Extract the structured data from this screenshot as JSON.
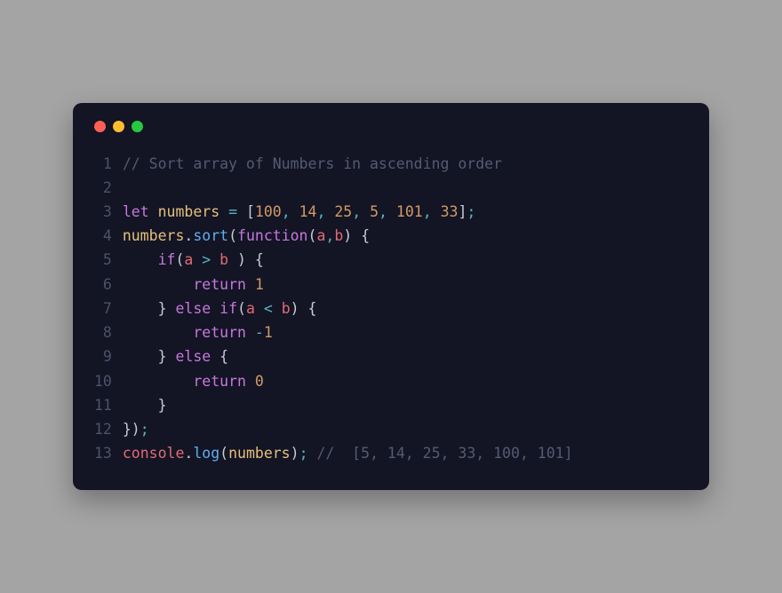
{
  "window": {
    "dots": [
      "red",
      "yellow",
      "green"
    ]
  },
  "code": {
    "numbers_array": [
      100,
      14,
      25,
      5,
      101,
      33
    ],
    "sorted_result": [
      5,
      14,
      25,
      33,
      100,
      101
    ],
    "lines": [
      {
        "n": "1",
        "tokens": [
          [
            "comment",
            "// Sort array of Numbers in ascending order"
          ]
        ]
      },
      {
        "n": "2",
        "tokens": []
      },
      {
        "n": "3",
        "tokens": [
          [
            "kw",
            "let"
          ],
          [
            "txt",
            " "
          ],
          [
            "var",
            "numbers"
          ],
          [
            "txt",
            " "
          ],
          [
            "op",
            "="
          ],
          [
            "txt",
            " "
          ],
          [
            "punct",
            "["
          ],
          [
            "num",
            "100"
          ],
          [
            "op",
            ","
          ],
          [
            "txt",
            " "
          ],
          [
            "num",
            "14"
          ],
          [
            "op",
            ","
          ],
          [
            "txt",
            " "
          ],
          [
            "num",
            "25"
          ],
          [
            "op",
            ","
          ],
          [
            "txt",
            " "
          ],
          [
            "num",
            "5"
          ],
          [
            "op",
            ","
          ],
          [
            "txt",
            " "
          ],
          [
            "num",
            "101"
          ],
          [
            "op",
            ","
          ],
          [
            "txt",
            " "
          ],
          [
            "num",
            "33"
          ],
          [
            "punct",
            "]"
          ],
          [
            "op",
            ";"
          ]
        ]
      },
      {
        "n": "4",
        "tokens": [
          [
            "var",
            "numbers"
          ],
          [
            "punct",
            "."
          ],
          [
            "method",
            "sort"
          ],
          [
            "punct",
            "("
          ],
          [
            "kw",
            "function"
          ],
          [
            "punct",
            "("
          ],
          [
            "ident",
            "a"
          ],
          [
            "op",
            ","
          ],
          [
            "ident",
            "b"
          ],
          [
            "punct",
            ")"
          ],
          [
            "txt",
            " "
          ],
          [
            "punct",
            "{"
          ]
        ]
      },
      {
        "n": "5",
        "tokens": [
          [
            "txt",
            "    "
          ],
          [
            "kw",
            "if"
          ],
          [
            "punct",
            "("
          ],
          [
            "ident",
            "a"
          ],
          [
            "txt",
            " "
          ],
          [
            "op",
            ">"
          ],
          [
            "txt",
            " "
          ],
          [
            "ident",
            "b"
          ],
          [
            "txt",
            " "
          ],
          [
            "punct",
            ")"
          ],
          [
            "txt",
            " "
          ],
          [
            "punct",
            "{"
          ]
        ]
      },
      {
        "n": "6",
        "tokens": [
          [
            "txt",
            "        "
          ],
          [
            "kw",
            "return"
          ],
          [
            "txt",
            " "
          ],
          [
            "num",
            "1"
          ]
        ]
      },
      {
        "n": "7",
        "tokens": [
          [
            "txt",
            "    "
          ],
          [
            "punct",
            "}"
          ],
          [
            "txt",
            " "
          ],
          [
            "kw",
            "else"
          ],
          [
            "txt",
            " "
          ],
          [
            "kw",
            "if"
          ],
          [
            "punct",
            "("
          ],
          [
            "ident",
            "a"
          ],
          [
            "txt",
            " "
          ],
          [
            "op",
            "<"
          ],
          [
            "txt",
            " "
          ],
          [
            "ident",
            "b"
          ],
          [
            "punct",
            ")"
          ],
          [
            "txt",
            " "
          ],
          [
            "punct",
            "{"
          ]
        ]
      },
      {
        "n": "8",
        "tokens": [
          [
            "txt",
            "        "
          ],
          [
            "kw",
            "return"
          ],
          [
            "txt",
            " "
          ],
          [
            "op",
            "-"
          ],
          [
            "num",
            "1"
          ]
        ]
      },
      {
        "n": "9",
        "tokens": [
          [
            "txt",
            "    "
          ],
          [
            "punct",
            "}"
          ],
          [
            "txt",
            " "
          ],
          [
            "kw",
            "else"
          ],
          [
            "txt",
            " "
          ],
          [
            "punct",
            "{"
          ]
        ]
      },
      {
        "n": "10",
        "tokens": [
          [
            "txt",
            "        "
          ],
          [
            "kw",
            "return"
          ],
          [
            "txt",
            " "
          ],
          [
            "num",
            "0"
          ]
        ]
      },
      {
        "n": "11",
        "tokens": [
          [
            "txt",
            "    "
          ],
          [
            "punct",
            "}"
          ]
        ]
      },
      {
        "n": "12",
        "tokens": [
          [
            "punct",
            "}"
          ],
          [
            "punct",
            ")"
          ],
          [
            "op",
            ";"
          ]
        ]
      },
      {
        "n": "13",
        "tokens": [
          [
            "ident",
            "console"
          ],
          [
            "punct",
            "."
          ],
          [
            "method",
            "log"
          ],
          [
            "punct",
            "("
          ],
          [
            "var",
            "numbers"
          ],
          [
            "punct",
            ")"
          ],
          [
            "op",
            ";"
          ],
          [
            "txt",
            " "
          ],
          [
            "comment",
            "//  [5, 14, 25, 33, 100, 101]"
          ]
        ]
      }
    ]
  }
}
